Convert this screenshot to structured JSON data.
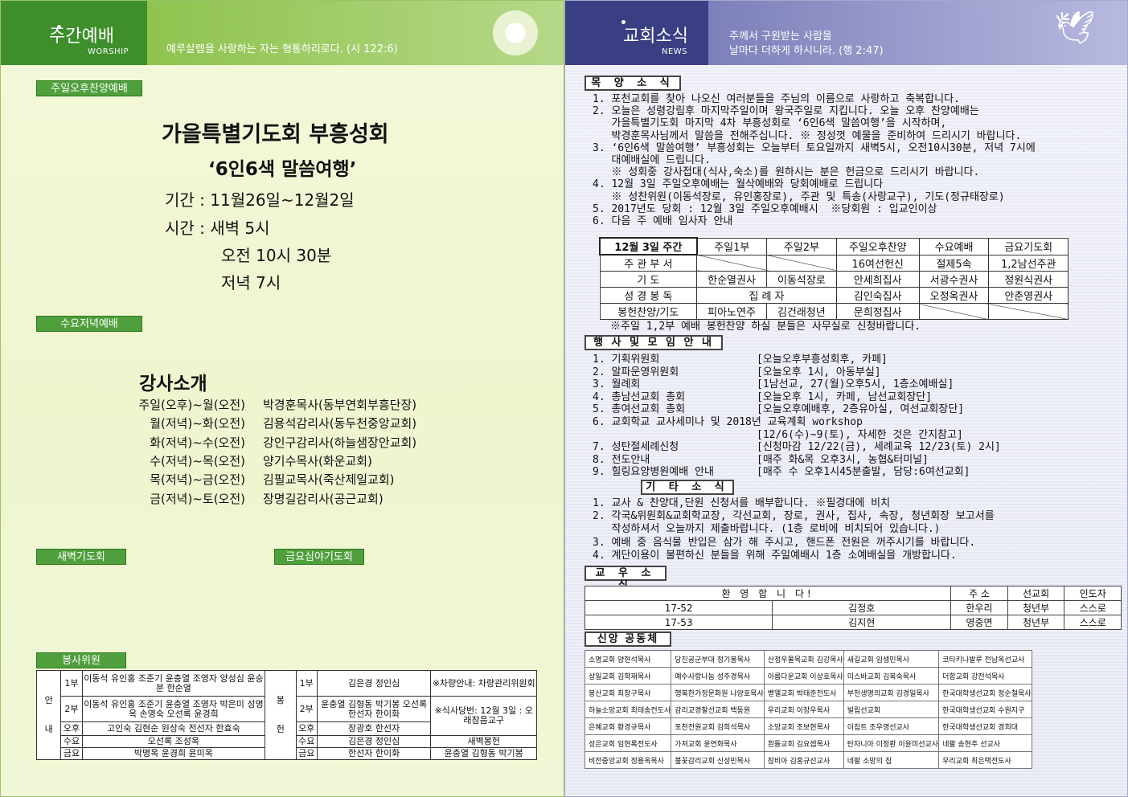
{
  "left": {
    "header": {
      "title": "주간예배",
      "subtitle": "WORSHIP",
      "verse": "예루살렘을 사랑하는 자는 형통하리로다. (시 122:6)"
    },
    "sunday_tag": "주일오후찬양예배",
    "event": {
      "title": "가을특별기도회 부흥성회",
      "theme": "‘6인6색 말씀여행’",
      "period": "기간 : 11월26일~12월2일",
      "time_label": "시간 : 새벽 5시",
      "time2": "오전 10시 30분",
      "time3": "저녁 7시"
    },
    "wed_tag": "수요저녁예배",
    "speakers": {
      "title": "강사소개",
      "items": [
        {
          "time": "주일(오후)~월(오전)",
          "name": "박경훈목사(동부연회부흥단장)"
        },
        {
          "time": "월(저녁)~화(오전)",
          "name": "김용석감리사(동두천중앙교회)"
        },
        {
          "time": "화(저녁)~수(오전)",
          "name": "강인구감리사(하늘샘장안교회)"
        },
        {
          "time": "수(저녁)~목(오전)",
          "name": "양기수목사(화운교회)"
        },
        {
          "time": "목(저녁)~금(오전)",
          "name": "김필교목사(죽산제일교회)"
        },
        {
          "time": "금(저녁)~토(오전)",
          "name": "장명길감리사(공근교회)"
        }
      ]
    },
    "dawn_tag": "새벽기도회",
    "fri_tag": "금요심야기도회",
    "service_tag": "봉사위원",
    "service": {
      "an": "안",
      "nae": "내",
      "bong": "봉",
      "heon": "헌",
      "r1": {
        "k": "1부",
        "names": "이동석 유인홍 조준기 윤충열 조영자 양성심 윤승분 한순열",
        "k2": "1부",
        "names2": "김은경 정인심",
        "note": "※차량안내: 차량관리위원회"
      },
      "r2": {
        "k": "2부",
        "names": "이동석 유인홍 조준기 윤충열 조영자 박은미 성명옥 손영숙 오선록 윤경희",
        "k2": "2부",
        "names2": "윤충열 김형동 박기봉 오선록 한선자 한이화",
        "note": "※식사당번: 12월 3일 : 오래참음교구"
      },
      "r3": {
        "k": "오후",
        "names": "고인숙 김현순 원상숙 전선자 한효숙",
        "k2": "오후",
        "names2": "장광호 한선자"
      },
      "r4": {
        "k": "수요",
        "names": "오선록 조성옥",
        "k2": "수요",
        "names2": "김은경 정인심",
        "note": "새벽봉헌"
      },
      "r5": {
        "k": "금요",
        "names": "박명옥 윤경희 윤미옥",
        "k2": "금요",
        "names2": "한선자 한이화",
        "note": "윤충열 김형동 박기봉"
      }
    }
  },
  "right": {
    "header": {
      "title": "교회소식",
      "subtitle": "NEWS",
      "verse1": "주께서 구원받는 사람을",
      "verse2": "날마다 더하게 하시니라. (행 2:47)"
    },
    "pastor_title": "목 양 소 식",
    "pastor_lines": [
      "1. 포천교회를 찾아 나오신 여러분들을 주님의 이름으로 사랑하고 축복합니다.",
      "2. 오늘은 성령강림후 마지막주일이며 왕국주일로 지킵니다. 오늘 오후 찬양예배는",
      "   가을특별기도회 마지막 4차 부흥성회로 ‘6인6색 말씀여행’을 시작하며,",
      "   박경훈목사님께서 말씀을 전해주십니다. ※ 정성껏 예물을 준비하여 드리시기 바랍니다.",
      "3. ‘6인6색 말씀여행’ 부흥성회는 오늘부터 토요일까지 새벽5시, 오전10시30분, 저녁 7시에",
      "   대예배실에 드립니다.",
      "   ※ 성회중 강사접대(식사,숙소)를 원하시는 분은 헌금으로 드리시기 바랍니다.",
      "4. 12월 3일 주일오후예배는 월삭예배와 당회예배로 드립니다",
      "   ※ 성찬위원(이동석장로, 유인홍장로), 주관 및 특송(사랑교구), 기도(정규태장로)",
      "5. 2017년도 당회 : 12월 3일 주일오후예배시  ※당회원 : 입교인이상",
      "6. 다음 주 예배 임사자 안내"
    ],
    "duty": {
      "head": [
        "12월 3일 주간",
        "주일1부",
        "주일2부",
        "주일오후찬양",
        "수요예배",
        "금요기도회"
      ],
      "rows": [
        [
          "주 관 부 서",
          "",
          "",
          "16여선헌신",
          "절제5속",
          "1,2남선주관"
        ],
        [
          "기 도",
          "한순열권사",
          "이동석장로",
          "안세희집사",
          "서광수권사",
          "정원식권사"
        ],
        [
          "성 경 봉 독",
          "집 례 자",
          "",
          "김인숙집사",
          "오정옥권사",
          "안춘영권사"
        ],
        [
          "봉헌찬양/기도",
          "피아노연주",
          "김건래청년",
          "문희정집사",
          "",
          ""
        ]
      ],
      "note": "※주일 1,2부 예배 봉헌찬양 하실 분들은 사무실로 신청바랍니다."
    },
    "events_title": "행 사 및 모 임 안 내",
    "events": [
      [
        "1. 기획위원회",
        "[오늘오후부흥성회후, 카페]"
      ],
      [
        "2. 알파운영위원회",
        "[오늘오후 1시, 아동부실]"
      ],
      [
        "3. 월례회",
        "[1남선교, 27(월)오후5시, 1층소예배실]"
      ],
      [
        "4. 총남선교회 총회",
        "[오늘오후 1시, 카페, 남선교회장단]"
      ],
      [
        "5. 총여선교회 총회",
        "[오늘오후예배후, 2층유아실, 여선교회장단]"
      ],
      [
        "6. 교회학교 교사세미나 및 2018년 교육계획 workshop",
        ""
      ],
      [
        "",
        "[12/6(수)~9(토), 자세한 것은 간지참고]"
      ],
      [
        "7. 성탄절세례신청",
        "[신청마감 12/22(금), 세례교육 12/23(토) 2시]"
      ],
      [
        "8. 전도안내",
        "[매주 화&목 오후3시, 농협&터미널]"
      ],
      [
        "9. 힐링요양병원예배 안내",
        "[매주 수 오후1시45분출발, 담당:6여선교회]"
      ]
    ],
    "etc_title": "기 타 소 식",
    "etc_lines": [
      "1. 교사 & 찬양대,단원 신청서를 배부합니다. ※필경대에 비치",
      "2. 각국&위원회&교회학교장, 각선교회, 장로, 권사, 집사, 속장, 청년회장 보고서를",
      "   작성하셔서 오늘까지 제출바랍니다. (1층 로비에 비치되어 있습니다.)",
      "3. 예배 중 음식물 반입은 삼가 해 주시고, 핸드폰 전원은 꺼주시기를 바랍니다.",
      "4. 계단이용이 불편하신 분들을 위해 주일예배시 1층 소예배실을 개방합니다."
    ],
    "members_title": "교 우 소 식",
    "members": {
      "head": [
        "환 영 합 니 다!",
        "",
        "주 소",
        "선교회",
        "인도자"
      ],
      "rows": [
        [
          "17-52",
          "김정호",
          "한우리",
          "청년부",
          "스스로"
        ],
        [
          "17-53",
          "김지현",
          "영중면",
          "청년부",
          "스스로"
        ]
      ]
    },
    "faith_title": "신앙 공동체",
    "faith": [
      [
        "소명교회 양현석목사",
        "당진공군부대 정기봉목사",
        "산정우물목교회 김강목사",
        "새길교회 임생민목사",
        "코타키나발루 전남옥선교사"
      ],
      [
        "상일교회 김학재목사",
        "예수사랑나눔 성주경목사",
        "아름다운교회 이상호목사",
        "미스바교회 김복숙목사",
        "더함교회 강전석목사"
      ],
      [
        "봉산교회 최창구목사",
        "행복한가정문화원 나양호목사",
        "벧엘교회 박태준전도사",
        "부천생명의교회 김경일목사",
        "한국대학생선교회 정순철목사"
      ],
      [
        "하늘소망교회 최태송전도사",
        "감리교경찰선교회 백동원",
        "우리교회 이장우목사",
        "빌립선교회",
        "한국대학생선교회 수원지구"
      ],
      [
        "은혜교회 황경규목사",
        "포천전원교회 김희석목사",
        "소망교회 조보현목사",
        "이집트 조우영선교사",
        "한국대학생선교회 경희대"
      ],
      [
        "성은교회 임현록전도사",
        "가져교회 윤연화목사",
        "흰돌교회 김요셉목사",
        "탄자니아 이정환 이윤미선교사",
        "네팔 송현주 선교사"
      ],
      [
        "비전중앙교회 정용옥목사",
        "불꽃감리교회 신성민목사",
        "잠비아 김홍규선교사",
        "네팔 소망의 집",
        "우리교회 최은택전도사"
      ]
    ]
  }
}
